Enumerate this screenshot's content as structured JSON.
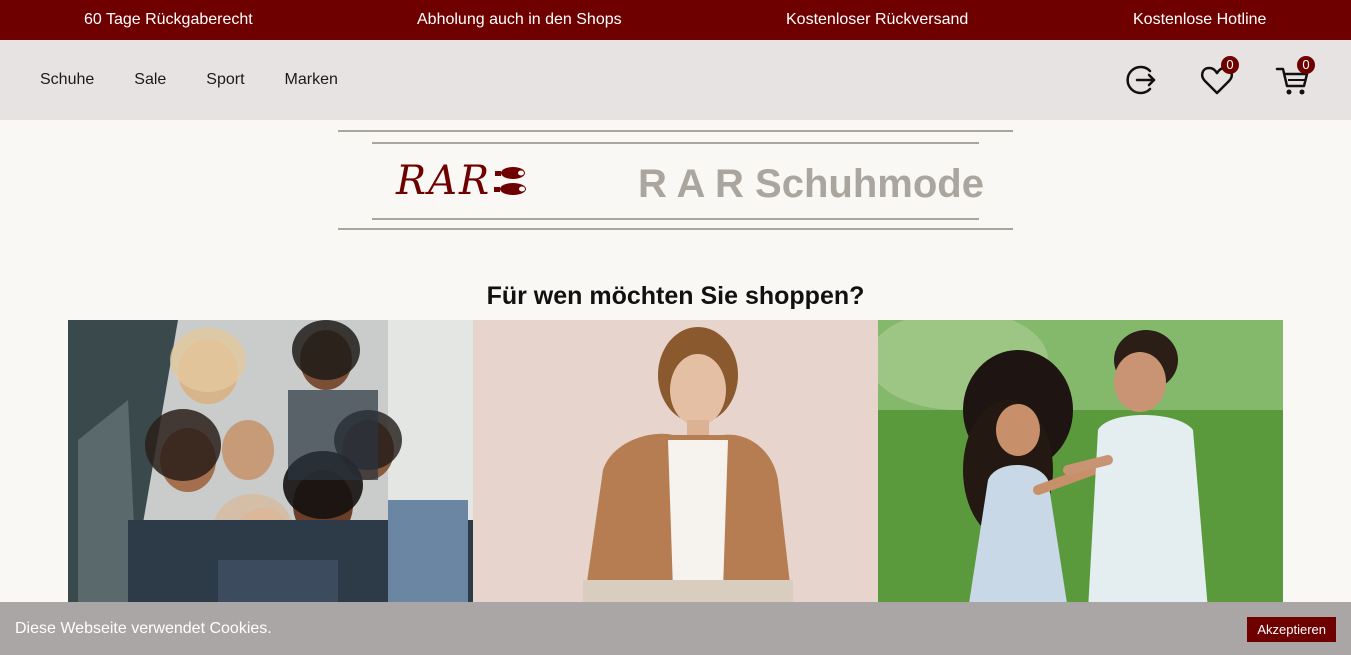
{
  "promo_bar": {
    "items": [
      "60 Tage Rückgaberecht",
      "Abholung auch in den Shops",
      "Kostenloser Rückversand",
      "Kostenlose Hotline"
    ]
  },
  "nav": {
    "links": [
      "Schuhe",
      "Sale",
      "Sport",
      "Marken"
    ],
    "icons": {
      "login": "login-icon",
      "wishlist": "heart-icon",
      "cart": "cart-icon"
    },
    "wishlist_count": "0",
    "cart_count": "0"
  },
  "logo": {
    "mark": "RAR",
    "text": "R A R Schuhmode"
  },
  "main": {
    "heading": "Für wen möchten Sie shoppen?"
  },
  "cookie_banner": {
    "text": "Diese Webseite verwendet Cookies.",
    "accept_label": "Akzeptieren"
  },
  "colors": {
    "brand": "#6e0000",
    "nav_bg": "#e7e3e3",
    "page_bg": "#f9f8f4",
    "logo_gray": "#aaa59f",
    "cookie_bg": "#aaa6a6"
  }
}
